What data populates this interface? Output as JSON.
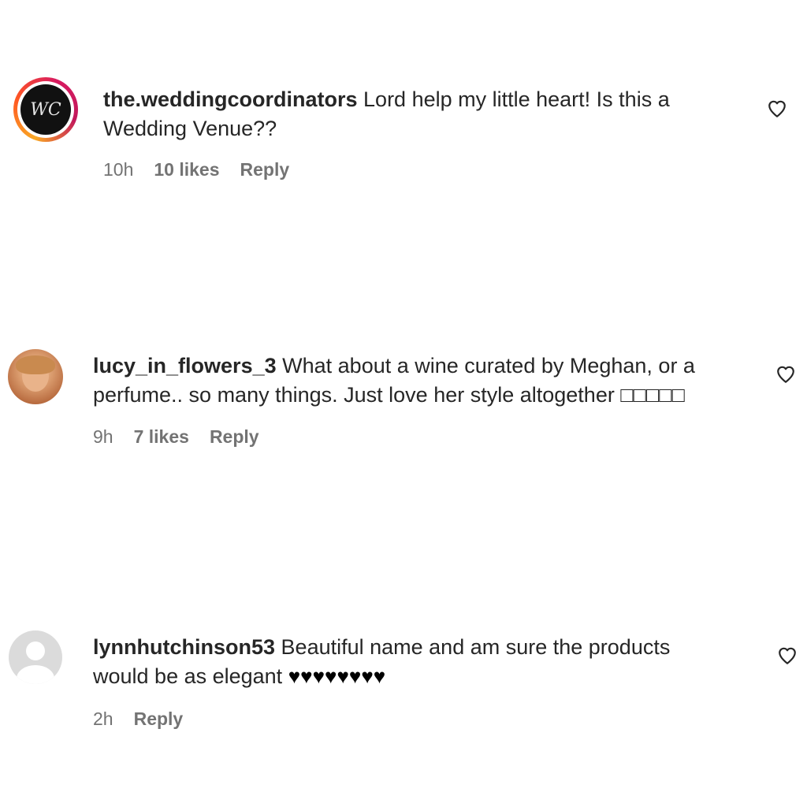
{
  "comments": [
    {
      "username": "the.weddingcoordinators",
      "text": "Lord help my little heart! Is this a",
      "text_line2": "Wedding Venue??",
      "time": "10h",
      "likes": "10 likes",
      "reply": "Reply",
      "avatar_monogram": "WC"
    },
    {
      "username": "lucy_in_flowers_3",
      "text": "What about a wine curated by Meghan, or a",
      "text_line2": "perfume.. so many things. Just love her style altogether □□□□□",
      "time": "9h",
      "likes": "7 likes",
      "reply": "Reply"
    },
    {
      "username": "lynnhutchinson53",
      "text": "Beautiful name and am sure the products",
      "text_line2": "would be as elegant",
      "hearts": "♥♥♥♥♥♥♥♥",
      "time": "2h",
      "reply": "Reply"
    }
  ],
  "colors": {
    "text": "#262626",
    "meta": "#737373",
    "story_ring_start": "#f9a825",
    "story_ring_end": "#d81b60"
  }
}
